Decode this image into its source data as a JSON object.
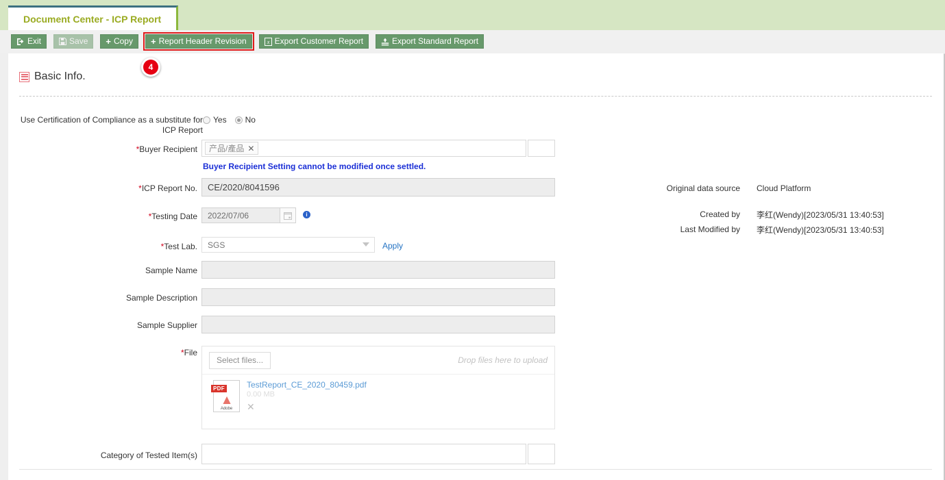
{
  "window": {
    "tab_label": "Document Center - ICP Report"
  },
  "toolbar": {
    "exit_label": "Exit",
    "save_label": "Save",
    "copy_label": "Copy",
    "report_header_revision_label": "Report Header Revision",
    "export_customer_report_label": "Export Customer Report",
    "export_standard_report_label": "Export Standard Report",
    "highlight_color": "#e01b1b",
    "button_color": "#67996b"
  },
  "marker": {
    "number": "4",
    "color": "#e60012"
  },
  "section": {
    "title": "Basic Info."
  },
  "form": {
    "coc_substitute": {
      "label": "Use Certification of Compliance as a substitute for ICP Report",
      "options": [
        "Yes",
        "No"
      ],
      "selected": "No"
    },
    "buyer_recipient": {
      "label": "Buyer Recipient",
      "required": true,
      "tag": "产品/產品",
      "remove_icon": "✕",
      "hint": "Buyer Recipient Setting cannot be modified once settled."
    },
    "icp_report_no": {
      "label": "ICP Report No.",
      "required": true,
      "value": "CE/2020/8041596"
    },
    "testing_date": {
      "label": "Testing Date",
      "required": true,
      "value": "2022/07/06",
      "info_icon": "i"
    },
    "test_lab": {
      "label": "Test Lab.",
      "required": true,
      "value": "SGS",
      "apply_label": "Apply"
    },
    "sample_name": {
      "label": "Sample Name",
      "value": ""
    },
    "sample_description": {
      "label": "Sample Description",
      "value": ""
    },
    "sample_supplier": {
      "label": "Sample Supplier",
      "value": ""
    },
    "file": {
      "label": "File",
      "required": true,
      "select_files_label": "Select files...",
      "drop_hint": "Drop files here to upload",
      "attachments": [
        {
          "name": "TestReport_CE_2020_80459.pdf",
          "size": "0.00 MB",
          "type_badge": "PDF",
          "type_brand": "Adobe",
          "remove_icon": "✕"
        }
      ]
    },
    "category_of_tested_items": {
      "label": "Category of Tested Item(s)",
      "value": ""
    }
  },
  "meta": {
    "original_data_source_label": "Original data source",
    "original_data_source_value": "Cloud Platform",
    "created_by_label": "Created by",
    "created_by_value": "李红(Wendy)[2023/05/31 13:40:53]",
    "last_modified_by_label": "Last Modified by",
    "last_modified_by_value": "李红(Wendy)[2023/05/31 13:40:53]"
  }
}
